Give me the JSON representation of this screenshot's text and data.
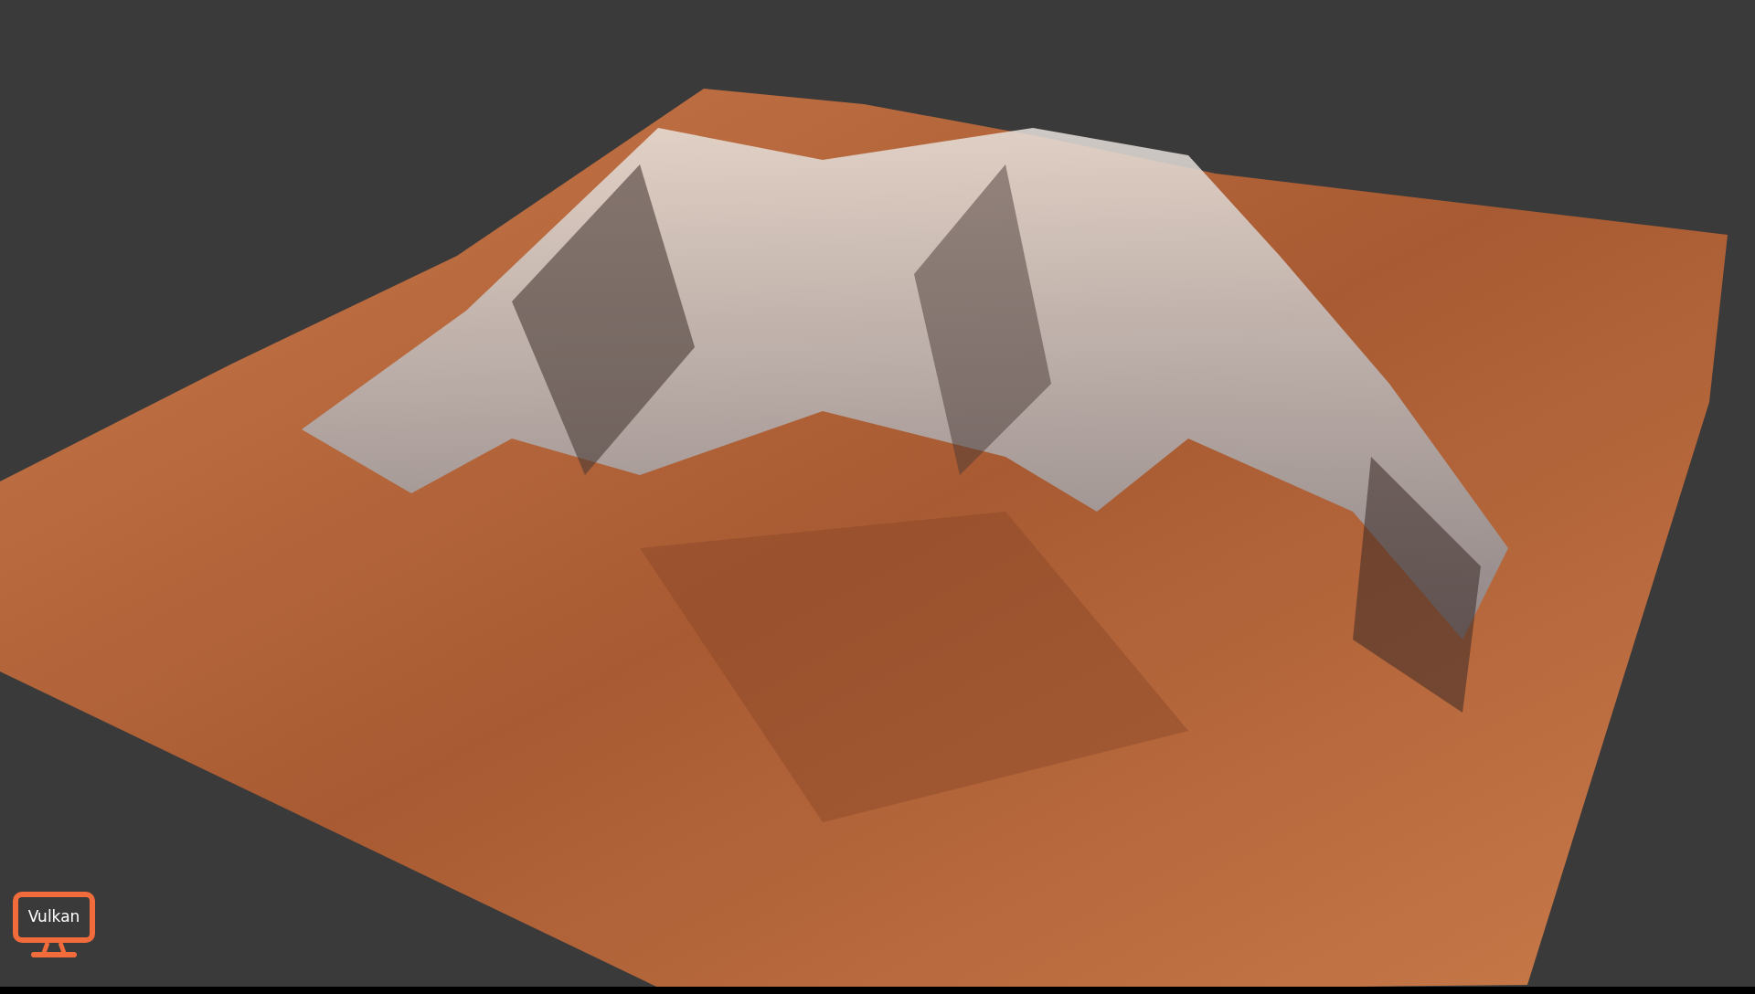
{
  "renderer_badge": {
    "label": "Vulkan"
  }
}
